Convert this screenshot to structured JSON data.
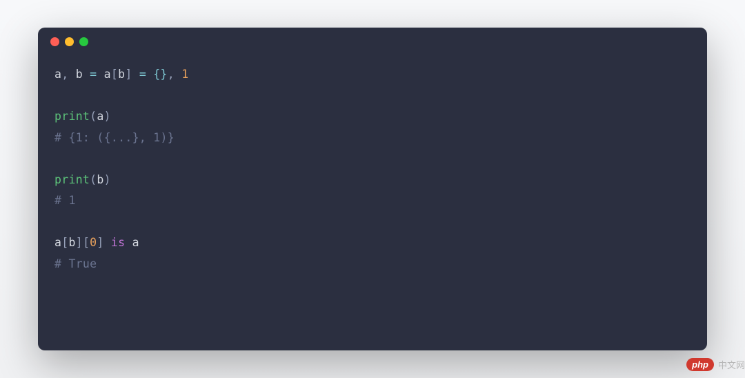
{
  "window": {
    "traffic_lights": [
      "red",
      "yellow",
      "green"
    ]
  },
  "code": {
    "lines": [
      {
        "tokens": [
          {
            "t": "a",
            "c": "ident"
          },
          {
            "t": ", ",
            "c": "punct"
          },
          {
            "t": "b",
            "c": "ident"
          },
          {
            "t": " ",
            "c": "punct"
          },
          {
            "t": "=",
            "c": "eq"
          },
          {
            "t": " ",
            "c": "punct"
          },
          {
            "t": "a",
            "c": "ident"
          },
          {
            "t": "[",
            "c": "punct"
          },
          {
            "t": "b",
            "c": "ident"
          },
          {
            "t": "]",
            "c": "punct"
          },
          {
            "t": " ",
            "c": "punct"
          },
          {
            "t": "=",
            "c": "eq"
          },
          {
            "t": " ",
            "c": "punct"
          },
          {
            "t": "{}",
            "c": "brace"
          },
          {
            "t": ", ",
            "c": "punct"
          },
          {
            "t": "1",
            "c": "num"
          }
        ]
      },
      {
        "tokens": []
      },
      {
        "tokens": [
          {
            "t": "print",
            "c": "func"
          },
          {
            "t": "(",
            "c": "punct"
          },
          {
            "t": "a",
            "c": "ident"
          },
          {
            "t": ")",
            "c": "punct"
          }
        ]
      },
      {
        "tokens": [
          {
            "t": "# {1: ({...}, 1)}",
            "c": "comment"
          }
        ]
      },
      {
        "tokens": []
      },
      {
        "tokens": [
          {
            "t": "print",
            "c": "func"
          },
          {
            "t": "(",
            "c": "punct"
          },
          {
            "t": "b",
            "c": "ident"
          },
          {
            "t": ")",
            "c": "punct"
          }
        ]
      },
      {
        "tokens": [
          {
            "t": "# 1",
            "c": "comment"
          }
        ]
      },
      {
        "tokens": []
      },
      {
        "tokens": [
          {
            "t": "a",
            "c": "ident"
          },
          {
            "t": "[",
            "c": "punct"
          },
          {
            "t": "b",
            "c": "ident"
          },
          {
            "t": "]",
            "c": "punct"
          },
          {
            "t": "[",
            "c": "punct"
          },
          {
            "t": "0",
            "c": "num"
          },
          {
            "t": "]",
            "c": "punct"
          },
          {
            "t": " ",
            "c": "punct"
          },
          {
            "t": "is",
            "c": "keyword"
          },
          {
            "t": " ",
            "c": "punct"
          },
          {
            "t": "a",
            "c": "ident"
          }
        ]
      },
      {
        "tokens": [
          {
            "t": "# True",
            "c": "comment"
          }
        ]
      }
    ]
  },
  "watermark": {
    "badge": "php",
    "text": "中文网"
  }
}
